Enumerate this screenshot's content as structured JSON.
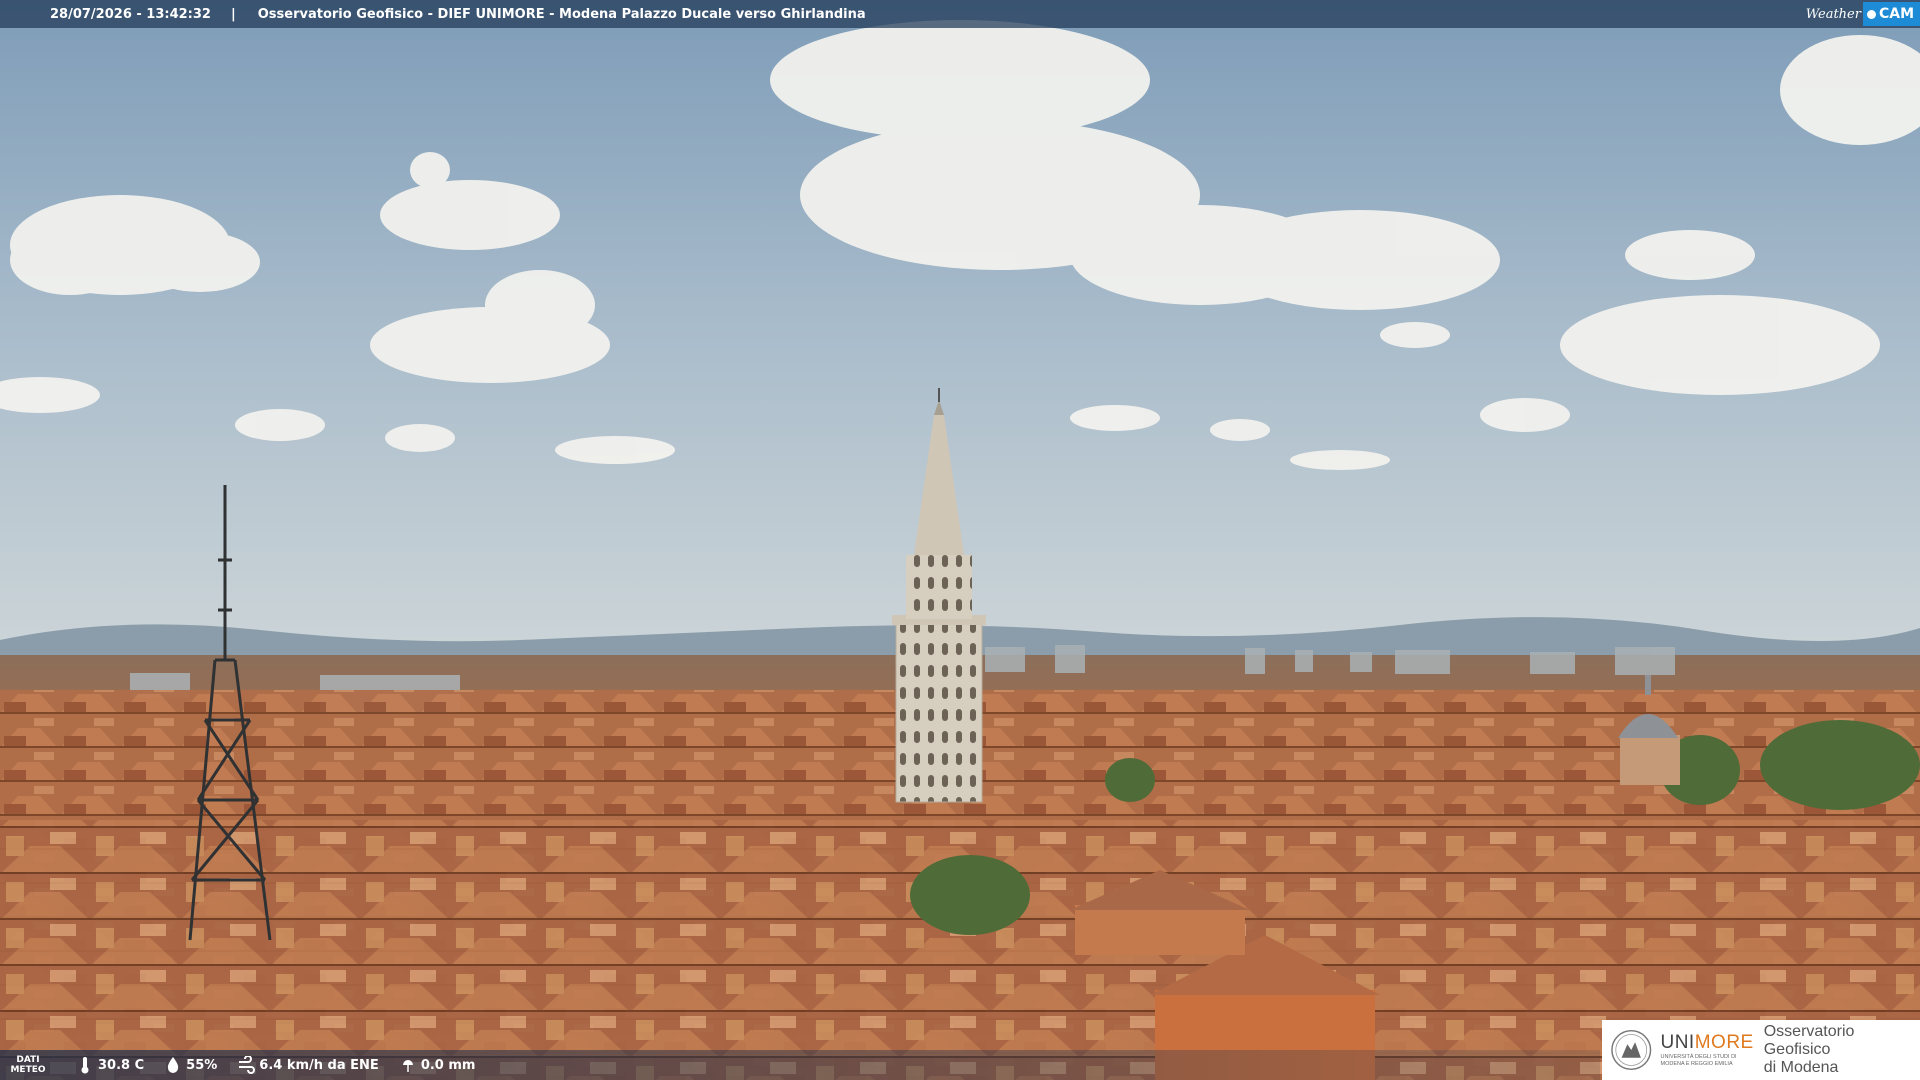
{
  "overlay": {
    "timestamp": "28/07/2026 - 13:42:32",
    "separator": "|",
    "title": "Osservatorio Geofisico - DIEF UNIMORE - Modena Palazzo Ducale verso Ghirlandina"
  },
  "brand": {
    "weather": "Weather",
    "cam": "CAM"
  },
  "weather": {
    "label_line1": "DATI",
    "label_line2": "METEO",
    "temperature": "30.8 C",
    "humidity": "55%",
    "wind": "6.4 km/h da ENE",
    "rain": "0.0 mm",
    "icons": [
      "thermometer-icon",
      "humidity-drop-icon",
      "wind-icon",
      "rain-icon"
    ]
  },
  "logo": {
    "uni": "UNI",
    "more": "MORE",
    "subline1": "UNIVERSITÀ DEGLI STUDI DI",
    "subline2": "MODENA E REGGIO EMILIA",
    "observatory_line1": "Osservatorio Geofisico",
    "observatory_line2": "di Modena"
  },
  "colors": {
    "sky_top": "#7f9db8",
    "sky_bottom": "#c9d3d8",
    "roof": "#b5714a",
    "tower": "#d9d2c4"
  }
}
